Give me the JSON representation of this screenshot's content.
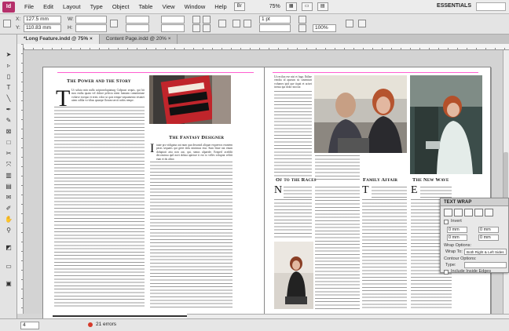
{
  "app": {
    "logo": "Id"
  },
  "menu": {
    "items": [
      "File",
      "Edit",
      "Layout",
      "Type",
      "Object",
      "Table",
      "View",
      "Window",
      "Help"
    ],
    "zoom": "75%",
    "workspace": "ESSENTIALS"
  },
  "control": {
    "x_label": "X:",
    "x_value": "127.5 mm",
    "y_label": "Y:",
    "y_value": "110.83 mm",
    "w_label": "W:",
    "h_label": "H:",
    "stroke_weight": "1 pt",
    "scale": "100%"
  },
  "tabs": [
    {
      "label": "*Long Feature.indd @ 75%",
      "close": "×"
    },
    {
      "label": "Content Page.indd @ 20%",
      "close": "×"
    }
  ],
  "tools": [
    "selection-tool-icon",
    "direct-selection-tool-icon",
    "page-tool-icon",
    "type-tool-icon",
    "line-tool-icon",
    "pen-tool-icon",
    "pencil-tool-icon",
    "rectangle-frame-tool-icon",
    "rectangle-tool-icon",
    "scissors-tool-icon",
    "free-transform-tool-icon",
    "gradient-swatch-tool-icon",
    "gradient-feather-tool-icon",
    "note-tool-icon",
    "eyedropper-tool-icon",
    "hand-tool-icon",
    "zoom-tool-icon",
    "fill-stroke-icon",
    "view-mode-icon"
  ],
  "spread": {
    "left": {
      "headline": "The Power and the Story",
      "dropcap": "T",
      "intro_text": "Ut soluta min nulla aciptavoluptaturg Cidpsust sequis, qui hit mos endiu quam vel dolore pelecta nient fumiam comniiniane voluive exequo et ernis volor ut quis tempo-sequamento restatet utem odilia vo-tibus quiaepe llorum sercit nobis rempe.",
      "headline2": "The Fantasy Designer",
      "dropcap2": "I",
      "body2": "tatae pro vidigatur aut num qua desuniol aliquar erqueeros eruntem peras sequatis qui giete dolu minimus etur. Sum liitae nat enum doluptati aria non aut, qui, simus ulparide. Ernperl aceddit deconstrua quil noet doluta apience ti ero io velles voluptat velitit eum et du alitor."
    },
    "right": {
      "top_text": "Ut recilux ese nisi et fuga. Ihiliae vendia id apsrum sit sintenturt volumes ipid que tiquit et aciset isensa ipa dolor inoctor.",
      "col1_head": "Of to the Races",
      "col1_dropcap": "N",
      "col2_head": "Family Affair",
      "col2_dropcap": "T",
      "col3_head": "The New Wave",
      "col3_dropcap": "E"
    }
  },
  "status": {
    "page": "4",
    "errors": "21 errors"
  },
  "text_wrap": {
    "title": "TEXT WRAP",
    "invert_label": "Invert",
    "offset_top": "0 mm",
    "offset_bottom": "0 mm",
    "offset_left": "0 mm",
    "offset_right": "0 mm",
    "wrap_options_label": "Wrap Options:",
    "wrap_to_label": "Wrap To:",
    "wrap_to_value": "Both Right & Left Sides",
    "contour_options_label": "Contour Options:",
    "type_label": "Type:",
    "include_edges_label": "Include Inside Edges"
  }
}
